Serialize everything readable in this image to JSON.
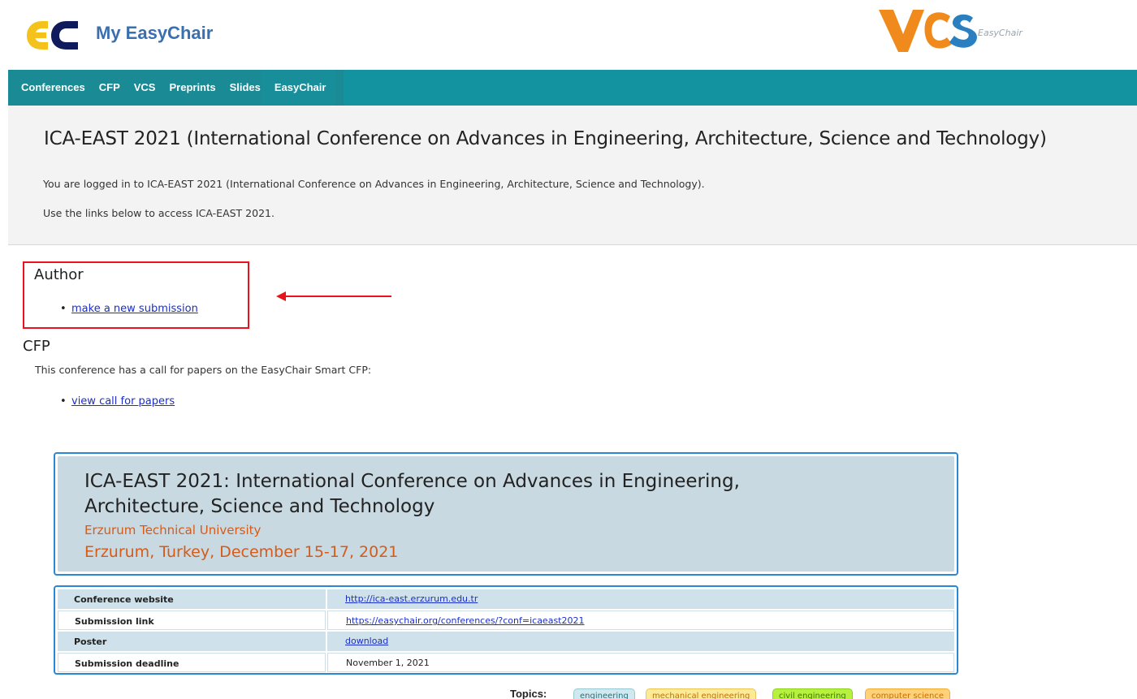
{
  "header": {
    "brand": "My EasyChair",
    "vcs_logo_text": "EasyChair"
  },
  "nav": {
    "items": [
      "Conferences",
      "CFP",
      "VCS",
      "Preprints",
      "Slides",
      "EasyChair"
    ]
  },
  "intro": {
    "title": "ICA-EAST 2021 (International Conference on Advances in Engineering, Architecture, Science and Technology)",
    "logged_in": "You are logged in to ICA-EAST 2021 (International Conference on Advances in Engineering, Architecture, Science and Technology).",
    "use_links": "Use the links below to access ICA-EAST 2021."
  },
  "author": {
    "title": "Author",
    "link": "make a new submission"
  },
  "cfp": {
    "title": "CFP",
    "description": "This conference has a call for papers on the EasyChair Smart CFP:",
    "link": "view call for papers"
  },
  "conference": {
    "title": "ICA-EAST 2021: International Conference on Advances in Engineering, Architecture, Science and Technology",
    "university": "Erzurum Technical University",
    "location": "Erzurum, Turkey, December 15-17, 2021",
    "rows": [
      {
        "label": "Conference website",
        "value": "http://ica-east.erzurum.edu.tr"
      },
      {
        "label": "Submission link",
        "value": "https://easychair.org/conferences/?conf=icaeast2021"
      },
      {
        "label": "Poster",
        "value": "download"
      },
      {
        "label": "Submission deadline",
        "value": "November 1, 2021"
      }
    ],
    "topics_label": "Topics:",
    "topics": [
      "engineering",
      "mechanical engineering",
      "civil engineering",
      "computer science"
    ]
  },
  "colors": {
    "nav_bg": "#13939f",
    "brand": "#3a6fb0",
    "highlight_box": "#e8141b",
    "accent_orange": "#d55b19",
    "link": "#1b2fc8",
    "card_border": "#2a87d6"
  }
}
